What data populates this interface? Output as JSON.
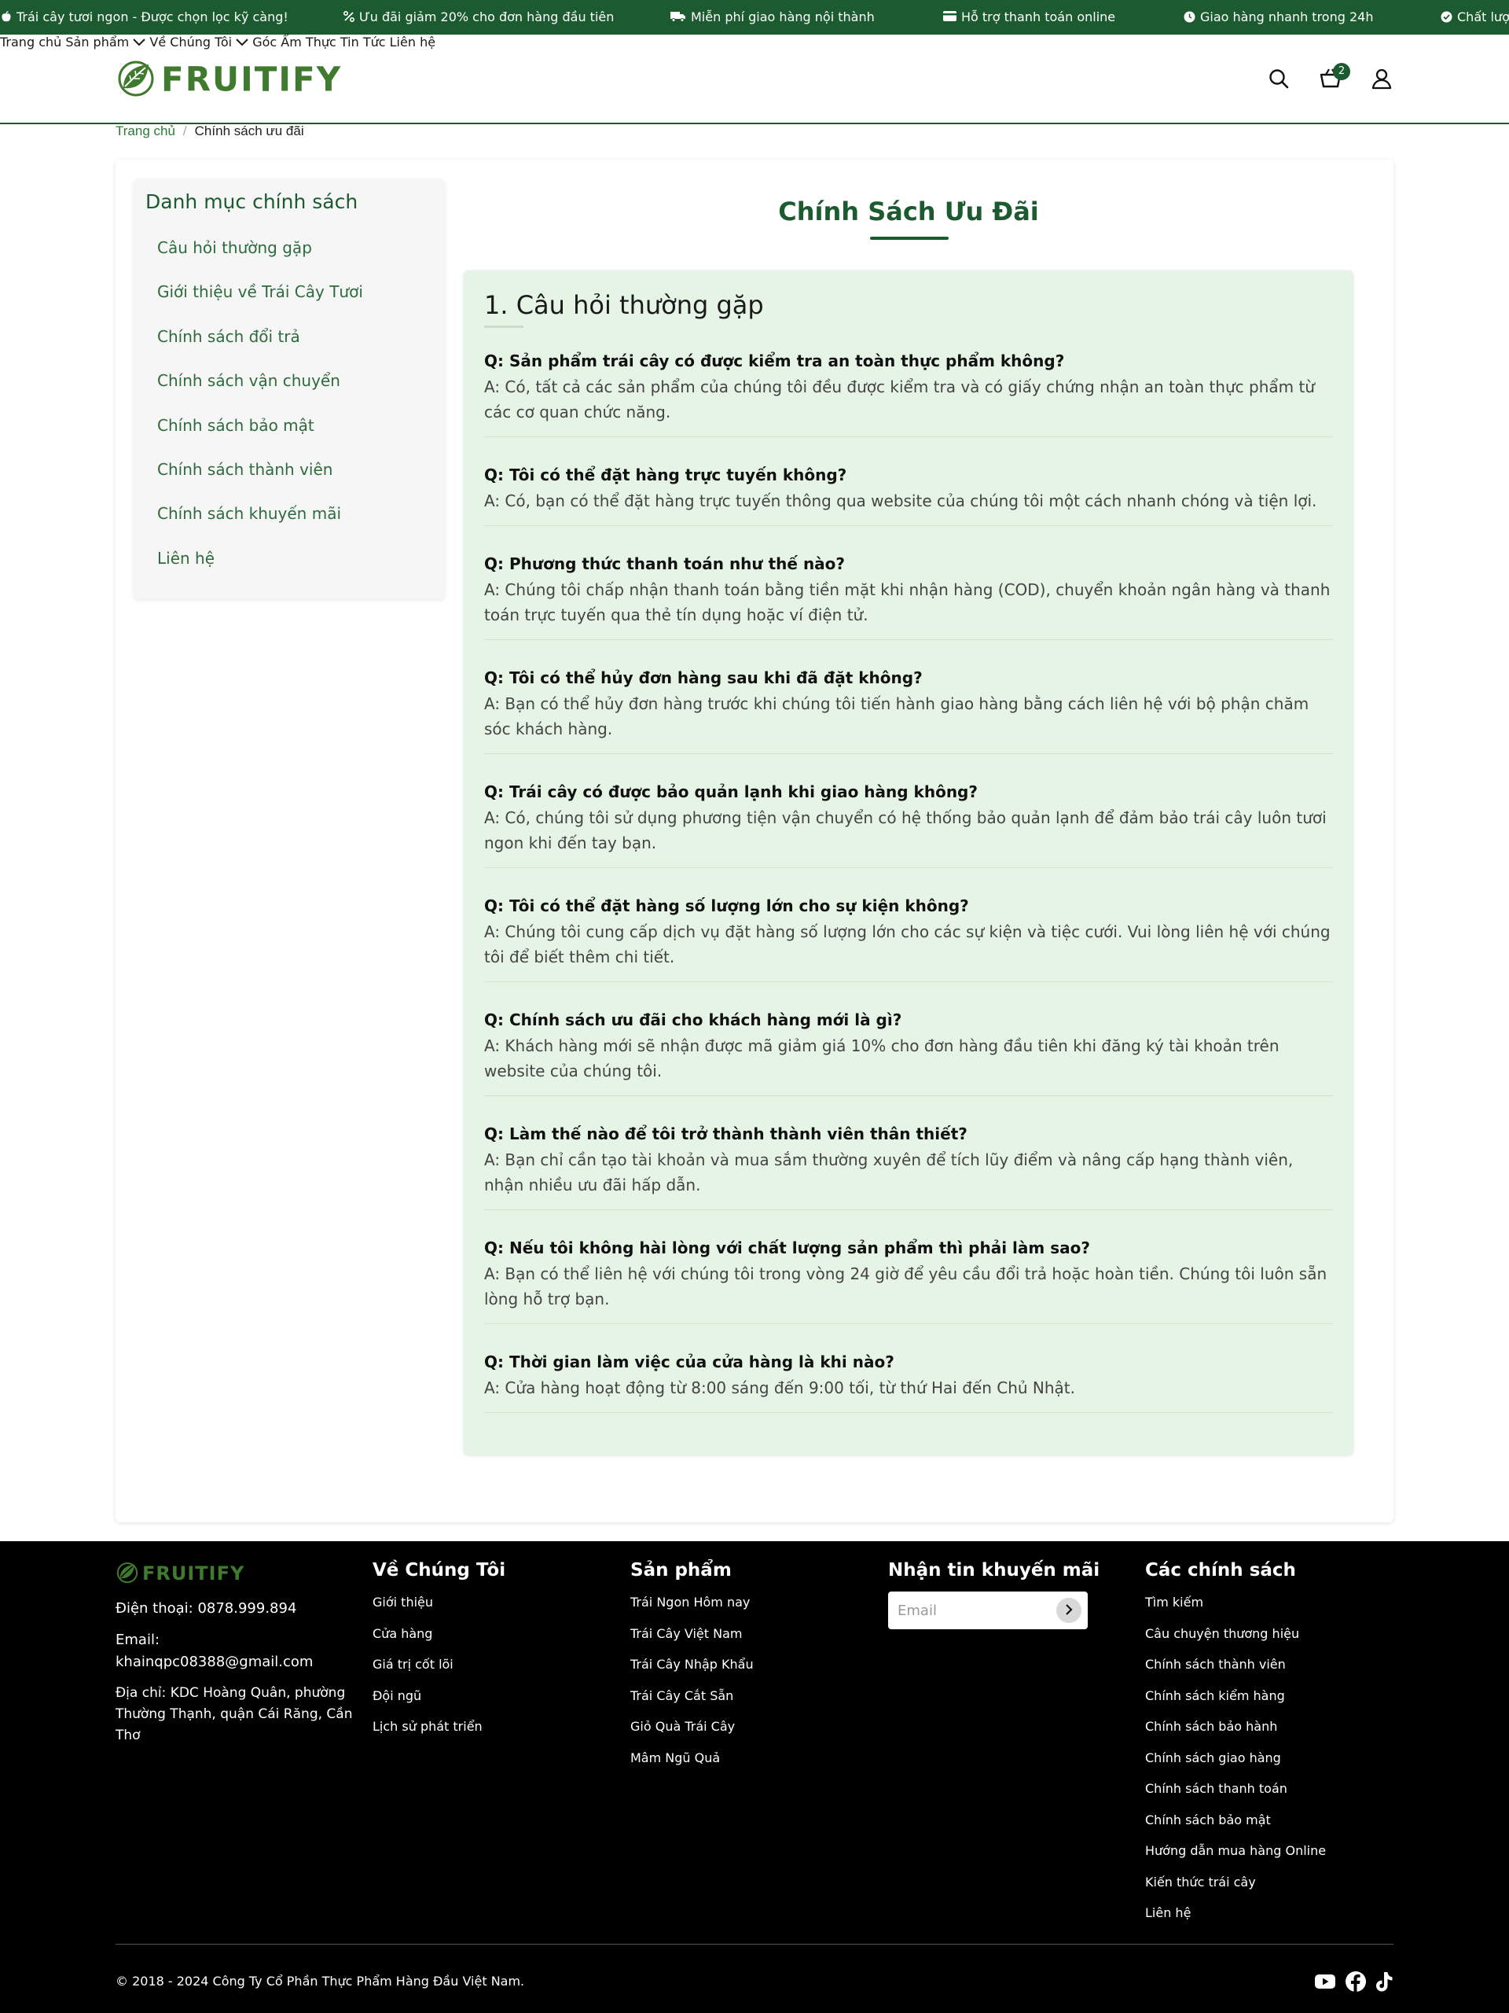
{
  "topbar": {
    "items": [
      {
        "icon": "apple-icon",
        "text": "Trái cây tươi ngon - Được chọn lọc kỹ càng!"
      },
      {
        "icon": "percent-icon",
        "text": "Ưu đãi giảm 20% cho đơn hàng đầu tiên"
      },
      {
        "icon": "truck-icon",
        "text": "Miễn phí giao hàng nội thành"
      },
      {
        "icon": "credit-card-icon",
        "text": "Hỗ trợ thanh toán online"
      },
      {
        "icon": "clock-icon",
        "text": "Giao hàng nhanh trong 24h"
      },
      {
        "icon": "check-circle-icon",
        "text": "Chất lượng"
      }
    ]
  },
  "header": {
    "logo_text": "FRUITIFY",
    "nav": [
      "Trang chủ",
      "Sản phẩm",
      "Về Chúng Tôi",
      "Góc Ẩm Thực",
      "Tin Tức",
      "Liên hệ"
    ],
    "cart_count": "2"
  },
  "breadcrumb": {
    "home": "Trang chủ",
    "separator": "/",
    "current": "Chính sách ưu đãi"
  },
  "sidebar": {
    "title": "Danh mục chính sách",
    "items": [
      "Câu hỏi thường gặp",
      "Giới thiệu về Trái Cây Tươi",
      "Chính sách đổi trả",
      "Chính sách vận chuyển",
      "Chính sách bảo mật",
      "Chính sách thành viên",
      "Chính sách khuyến mãi",
      "Liên hệ"
    ]
  },
  "content": {
    "page_title": "Chính Sách Ưu Đãi",
    "section_heading": "1. Câu hỏi thường gặp",
    "faqs": [
      {
        "q": "Q: Sản phẩm trái cây có được kiểm tra an toàn thực phẩm không?",
        "a": "A: Có, tất cả các sản phẩm của chúng tôi đều được kiểm tra và có giấy chứng nhận an toàn thực phẩm từ các cơ quan chức năng."
      },
      {
        "q": "Q: Tôi có thể đặt hàng trực tuyến không?",
        "a": "A: Có, bạn có thể đặt hàng trực tuyến thông qua website của chúng tôi một cách nhanh chóng và tiện lợi."
      },
      {
        "q": "Q: Phương thức thanh toán như thế nào?",
        "a": "A: Chúng tôi chấp nhận thanh toán bằng tiền mặt khi nhận hàng (COD), chuyển khoản ngân hàng và thanh toán trực tuyến qua thẻ tín dụng hoặc ví điện tử."
      },
      {
        "q": "Q: Tôi có thể hủy đơn hàng sau khi đã đặt không?",
        "a": "A: Bạn có thể hủy đơn hàng trước khi chúng tôi tiến hành giao hàng bằng cách liên hệ với bộ phận chăm sóc khách hàng."
      },
      {
        "q": "Q: Trái cây có được bảo quản lạnh khi giao hàng không?",
        "a": "A: Có, chúng tôi sử dụng phương tiện vận chuyển có hệ thống bảo quản lạnh để đảm bảo trái cây luôn tươi ngon khi đến tay bạn."
      },
      {
        "q": "Q: Tôi có thể đặt hàng số lượng lớn cho sự kiện không?",
        "a": "A: Chúng tôi cung cấp dịch vụ đặt hàng số lượng lớn cho các sự kiện và tiệc cưới. Vui lòng liên hệ với chúng tôi để biết thêm chi tiết."
      },
      {
        "q": "Q: Chính sách ưu đãi cho khách hàng mới là gì?",
        "a": "A: Khách hàng mới sẽ nhận được mã giảm giá 10% cho đơn hàng đầu tiên khi đăng ký tài khoản trên website của chúng tôi."
      },
      {
        "q": "Q: Làm thế nào để tôi trở thành thành viên thân thiết?",
        "a": "A: Bạn chỉ cần tạo tài khoản và mua sắm thường xuyên để tích lũy điểm và nâng cấp hạng thành viên, nhận nhiều ưu đãi hấp dẫn."
      },
      {
        "q": "Q: Nếu tôi không hài lòng với chất lượng sản phẩm thì phải làm sao?",
        "a": "A: Bạn có thể liên hệ với chúng tôi trong vòng 24 giờ để yêu cầu đổi trả hoặc hoàn tiền. Chúng tôi luôn sẵn lòng hỗ trợ bạn."
      },
      {
        "q": "Q: Thời gian làm việc của cửa hàng là khi nào?",
        "a": "A: Cửa hàng hoạt động từ 8:00 sáng đến 9:00 tối, từ thứ Hai đến Chủ Nhật."
      }
    ]
  },
  "footer": {
    "logo_text": "FRUITIFY",
    "phone": "Điện thoại: 0878.999.894",
    "email": "Email: khainqpc08388@gmail.com",
    "address": "Địa chỉ: KDC Hoàng Quân, phường Thường Thạnh, quận Cái Răng, Cần Thơ",
    "about": {
      "title": "Về Chúng Tôi",
      "links": [
        "Giới thiệu",
        "Cửa hàng",
        "Giá trị cốt lõi",
        "Đội ngũ",
        "Lịch sử phát triển"
      ]
    },
    "products": {
      "title": "Sản phẩm",
      "links": [
        "Trái Ngon Hôm nay",
        "Trái Cây Việt Nam",
        "Trái Cây Nhập Khẩu",
        "Trái Cây Cắt Sẵn",
        "Giỏ Quà Trái Cây",
        "Mâm Ngũ Quả"
      ]
    },
    "newsletter": {
      "title": "Nhận tin khuyến mãi",
      "placeholder": "Email"
    },
    "policies": {
      "title": "Các chính sách",
      "links": [
        "Tìm kiếm",
        "Câu chuyện thương hiệu",
        "Chính sách thành viên",
        "Chính sách kiểm hàng",
        "Chính sách bảo hành",
        "Chính sách giao hàng",
        "Chính sách thanh toán",
        "Chính sách bảo mật",
        "Hướng dẫn mua hàng Online",
        "Kiến thức trái cây",
        "Liên hệ"
      ]
    },
    "copyright": "© 2018 - 2024 Công Ty Cổ Phần Thực Phẩm Hàng Đầu Việt Nam."
  },
  "colors": {
    "brand_dark": "#1c5a2f",
    "brand_logo": "#3f7a2e",
    "faq_bg": "#e6f4e6",
    "footer_bg": "#000000"
  }
}
